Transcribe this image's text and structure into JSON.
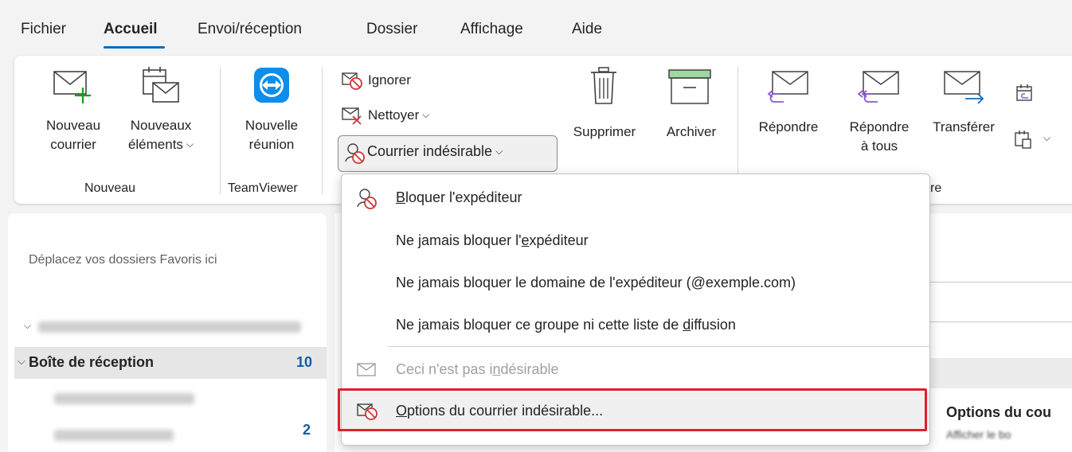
{
  "menubar": {
    "tabs": [
      "Fichier",
      "Accueil",
      "Envoi/réception",
      "Dossier",
      "Affichage",
      "Aide"
    ],
    "active": "Accueil"
  },
  "ribbon": {
    "new_mail": [
      "Nouveau",
      "courrier"
    ],
    "new_items": [
      "Nouveaux",
      "éléments"
    ],
    "group_nouveau": "Nouveau",
    "new_meeting": [
      "Nouvelle",
      "réunion"
    ],
    "group_teamviewer": "TeamViewer",
    "ignore": "Ignorer",
    "cleanup": "Nettoyer",
    "junk": "Courrier indésirable",
    "delete": "Supprimer",
    "archive": "Archiver",
    "reply": "Répondre",
    "reply_all": [
      "Répondre",
      "à tous"
    ],
    "forward": "Transférer",
    "group_respond_tail": "re"
  },
  "leftpane": {
    "favorites_hint": "Déplacez vos dossiers Favoris ici",
    "inbox_label": "Boîte de réception",
    "inbox_count": "10",
    "sub_count": "2"
  },
  "dropdown": {
    "items": [
      {
        "pre": "",
        "u": "B",
        "post": "loquer l'expéditeur"
      },
      {
        "pre": "Ne jamais bloquer l'",
        "u": "e",
        "post": "xpéditeur"
      },
      {
        "pre": "Ne ",
        "u": "j",
        "post": "amais bloquer le domaine de l'expéditeur (@exemple.com)"
      },
      {
        "pre": "Ne jamais bloquer ce groupe ni cette liste de ",
        "u": "d",
        "post": "iffusion"
      },
      {
        "pre": "Ceci n'est pas i",
        "u": "n",
        "post": "désirable"
      },
      {
        "pre": "",
        "u": "O",
        "post": "ptions du courrier indésirable..."
      }
    ]
  },
  "tooltip": {
    "title": "Options du cou",
    "subtitle": "Afficher le bo"
  },
  "colors": {
    "accent": "#0f6cbd",
    "highlight_border": "#e0202a",
    "count_blue": "#115ea3"
  }
}
